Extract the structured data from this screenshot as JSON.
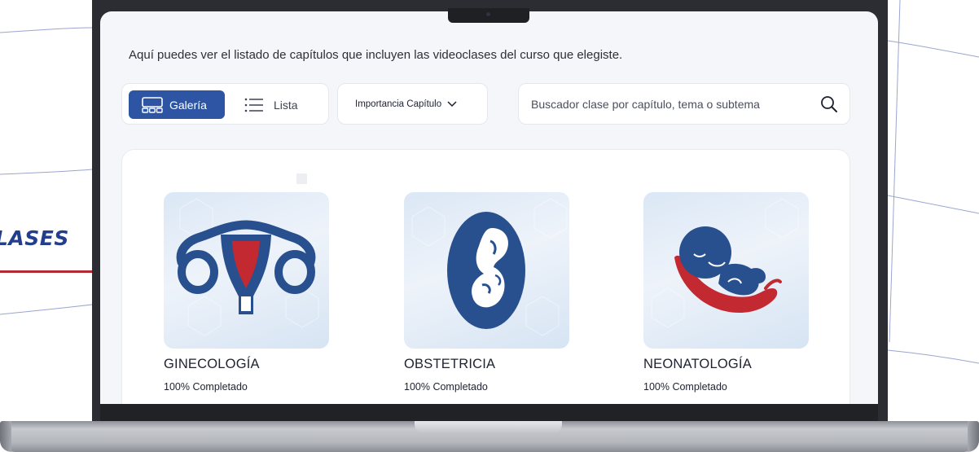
{
  "side": {
    "title": "LASES"
  },
  "intro_text": "Aquí puedes ver el listado de capítulos que incluyen las videoclases del curso que elegiste.",
  "view_toggle": {
    "gallery_label": "Galería",
    "list_label": "Lista",
    "active": "gallery"
  },
  "sort": {
    "label": "Importancia Capítulo"
  },
  "search": {
    "placeholder": "Buscador clase por capítulo, tema o subtema"
  },
  "chapters": [
    {
      "title": "GINECOLOGÍA",
      "progress": "100% Completado",
      "icon": "uterus-icon"
    },
    {
      "title": "OBSTETRICIA",
      "progress": "100% Completado",
      "icon": "fetus-icon"
    },
    {
      "title": "NEONATOLOGÍA",
      "progress": "100% Completado",
      "icon": "newborn-icon"
    }
  ],
  "colors": {
    "primary": "#2d55a3",
    "accent_red": "#b22a32",
    "illustration_blue": "#28508f"
  }
}
